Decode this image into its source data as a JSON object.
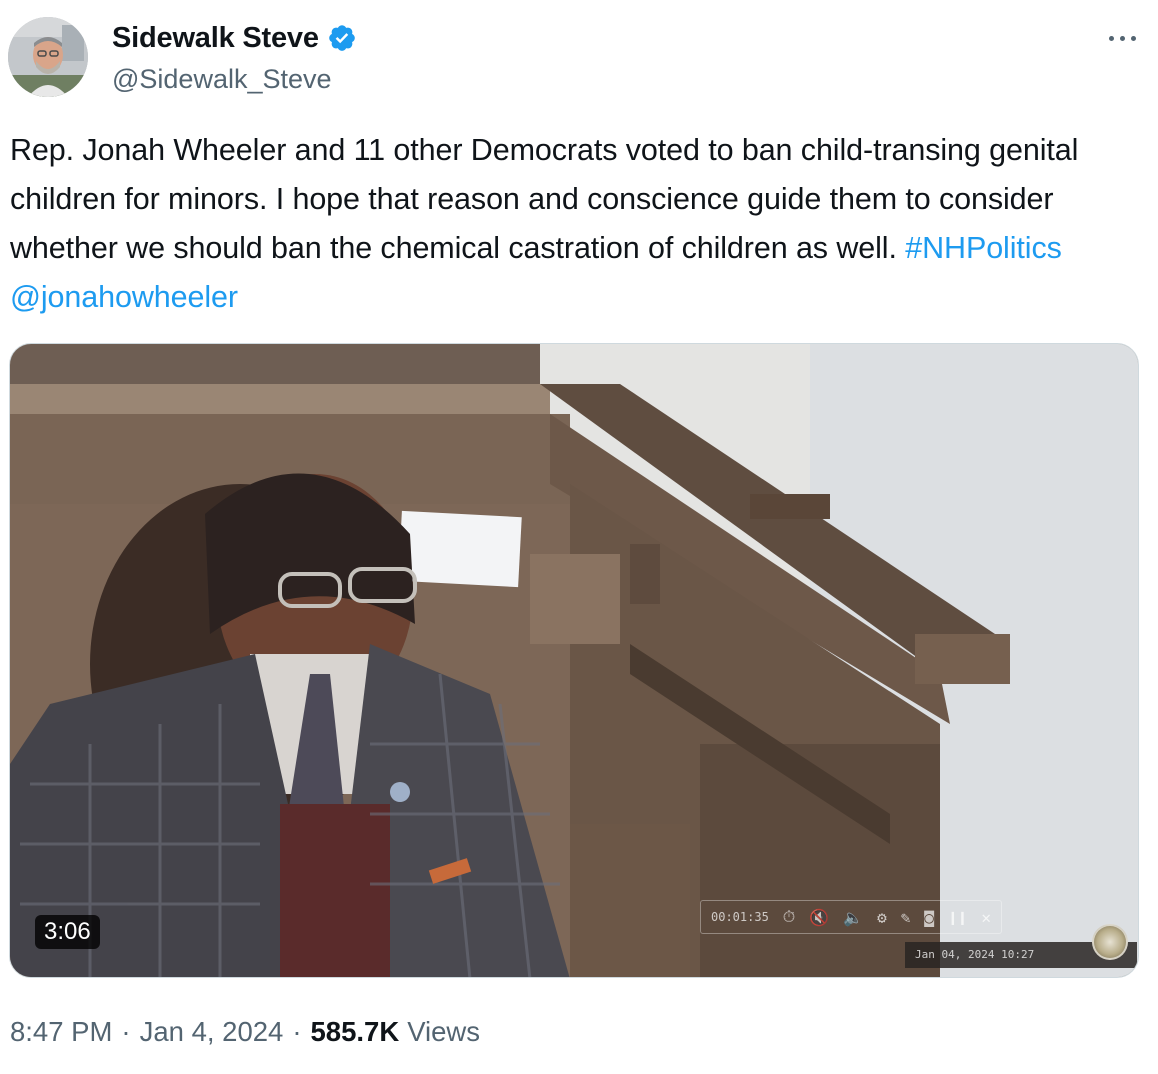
{
  "author": {
    "display_name": "Sidewalk Steve",
    "handle": "@Sidewalk_Steve",
    "verified": true,
    "avatar_icon": "avatar-photo"
  },
  "tweet": {
    "text_plain": "Rep. Jonah Wheeler and 11 other Democrats voted to ban child-transing genital children for minors. I hope that reason and conscience guide them to consider whether we should ban the chemical castration of children as well.",
    "hashtag": "#NHPolitics",
    "mention": "@jonahowheeler",
    "link_color": "#1d9bf0"
  },
  "media": {
    "duration": "3:06",
    "overlay_time": "00:01:35",
    "overlay_stamp": "Jan 04, 2024 10:27"
  },
  "meta": {
    "time": "8:47 PM",
    "separator": "·",
    "date": "Jan 4, 2024",
    "views_count": "585.7K",
    "views_label": "Views"
  },
  "more_button": {
    "icon": "more-horizontal-icon"
  }
}
